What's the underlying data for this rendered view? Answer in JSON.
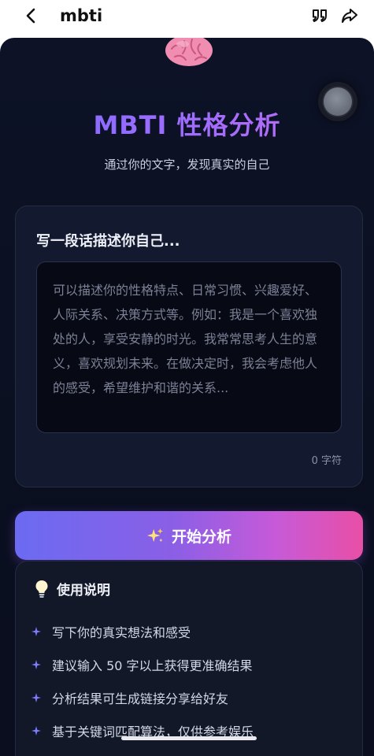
{
  "nav": {
    "title": "mbti"
  },
  "hero": {
    "title": "MBTI 性格分析",
    "subtitle": "通过你的文字，发现真实的自己"
  },
  "input_card": {
    "label": "写一段话描述你自己...",
    "placeholder": "可以描述你的性格特点、日常习惯、兴趣爱好、人际关系、决策方式等。例如：我是一个喜欢独处的人，享受安静的时光。我常常思考人生的意义，喜欢规划未来。在做决定时，我会考虑他人的感受，希望维护和谐的关系...",
    "char_count": "0 字符"
  },
  "analyze_button": {
    "label": "开始分析",
    "icon": "sparkle-icon"
  },
  "usage": {
    "title": "使用说明",
    "icon": "lightbulb-icon",
    "tips": [
      "写下你的真实想法和感受",
      "建议输入 50 字以上获得更准确结果",
      "分析结果可生成链接分享给好友",
      "基于关键词匹配算法，仅供参考娱乐"
    ]
  },
  "colors": {
    "background": "#0b1022",
    "card": "#131a30",
    "accent_start": "#6b6bf2",
    "accent_end": "#e84fa6",
    "title_gradient_start": "#7c6cff",
    "title_gradient_end": "#c06bf0"
  }
}
